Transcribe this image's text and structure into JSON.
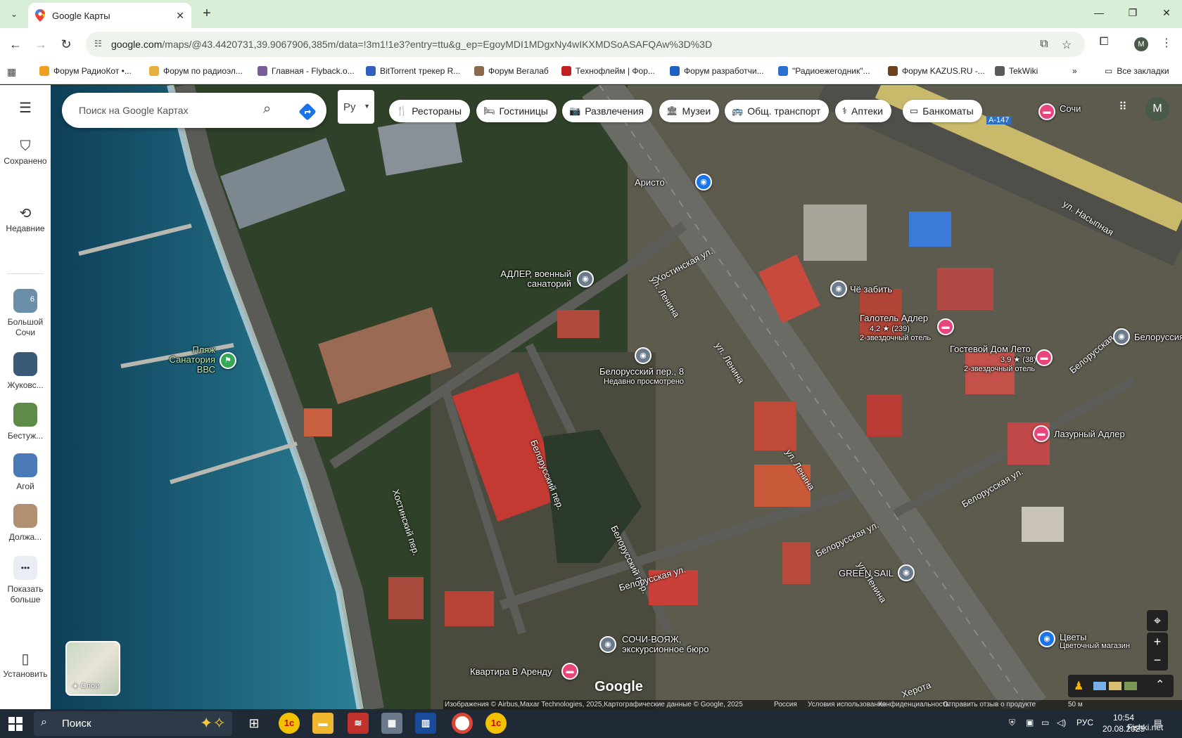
{
  "browser": {
    "tab_title": "Google Карты",
    "url_host": "google.com",
    "url_path": "/maps/@43.4420731,39.9067906,385m/data=!3m1!1e3?entry=ttu&g_ep=EgoyMDI1MDgxNy4wIKXMDSoASAFQAw%3D%3D",
    "profile_initial": "M",
    "bookmarks": [
      {
        "label": "Форум РадиоКот •...",
        "color": "#f0a020"
      },
      {
        "label": "Форум по радиоэл...",
        "color": "#e8b040"
      },
      {
        "label": "Главная - Flyback.o...",
        "color": "#7a5c9a"
      },
      {
        "label": "BitTorrent трекер R...",
        "color": "#3060c0"
      },
      {
        "label": "Форум Вегалаб",
        "color": "#8a6a4a"
      },
      {
        "label": "Технофлейм | Фор...",
        "color": "#c02020"
      },
      {
        "label": "Форум разработчи...",
        "color": "#2060c0"
      },
      {
        "label": "\"Радиоежегодник\"...",
        "color": "#2a70d0"
      },
      {
        "label": "Форум KAZUS.RU -...",
        "color": "#6a4020"
      },
      {
        "label": "TekWiki",
        "color": "#5a5a5a"
      }
    ],
    "bookmarks_all": "Все закладки"
  },
  "rail": {
    "saved": "Сохранено",
    "recent": "Недавние",
    "places": [
      {
        "label": "Большой Сочи",
        "badge": "6",
        "color": "#6b8fa8"
      },
      {
        "label": "Жуковс...",
        "color": "#3a5a78"
      },
      {
        "label": "Бестуж...",
        "color": "#5e8a4a"
      },
      {
        "label": "Агой",
        "color": "#4a7ab8"
      },
      {
        "label": "Должа...",
        "color": "#b09070"
      }
    ],
    "more": "Показать больше",
    "install": "Установить"
  },
  "search": {
    "placeholder": "Поиск на Google Картах",
    "lang": "Ру"
  },
  "chips": [
    {
      "label": "Рестораны",
      "icon": "fork-knife-icon"
    },
    {
      "label": "Гостиницы",
      "icon": "bed-icon"
    },
    {
      "label": "Развлечения",
      "icon": "camera-icon"
    },
    {
      "label": "Музеи",
      "icon": "museum-icon"
    },
    {
      "label": "Общ. транспорт",
      "icon": "bus-icon"
    },
    {
      "label": "Аптеки",
      "icon": "pharmacy-icon"
    },
    {
      "label": "Банкоматы",
      "icon": "atm-icon"
    }
  ],
  "map": {
    "places": {
      "aristo": "Аристо",
      "adler_sanatorium": "АДЛЕР, военный санаторий",
      "beach": "Пляж Санатория ВВС",
      "belorussky8": "Белорусский пер., 8",
      "recently_viewed": "Недавно просмотрено",
      "chezabit": "Чё забить",
      "galotel": "Галотель Адлер",
      "galotel_rating": "4,2",
      "galotel_reviews": "(239)",
      "galotel_class": "2-звездочный отель",
      "guest_house": "Гостевой Дом Лето",
      "guest_rating": "3,9",
      "guest_reviews": "(38)",
      "guest_class": "2-звездочный отель",
      "lazurny": "Лазурный Адлер",
      "green_sail": "GREEN SAIL",
      "sochi_voyage": "СОЧИ-ВОЯЖ, экскурсионное бюро",
      "kvartira": "Квартира В Аренду",
      "tsvety": "Цветы",
      "tsvety_sub": "Цветочный магазин",
      "sochi": "Сочи",
      "belorussia": "Белоруссия",
      "a147": "А-147"
    },
    "streets": {
      "lenina": "ул. Ленина",
      "khostinskaya": "Хостинская ул.",
      "khostinsky_per": "Хостинский пер.",
      "belorussky_per": "Белорусский пер.",
      "belorusskaya": "Белорусская ул.",
      "nasypnaya": "ул. Насыпная",
      "kherota": "Херота"
    },
    "layers": "Слои",
    "attribution": "Изображения © Airbus,Maxar Technologies, 2025,Картографические данные © Google, 2025",
    "country": "Россия",
    "terms": "Условия использования",
    "privacy": "Конфиденциальность",
    "feedback": "Отправить отзыв о продукте",
    "scale": "50 м",
    "google": "Google"
  },
  "taskbar": {
    "search": "Поиск",
    "lang": "РУС",
    "time": "10:54",
    "date": "20.08.2025",
    "watermark": "Fishki.net"
  }
}
